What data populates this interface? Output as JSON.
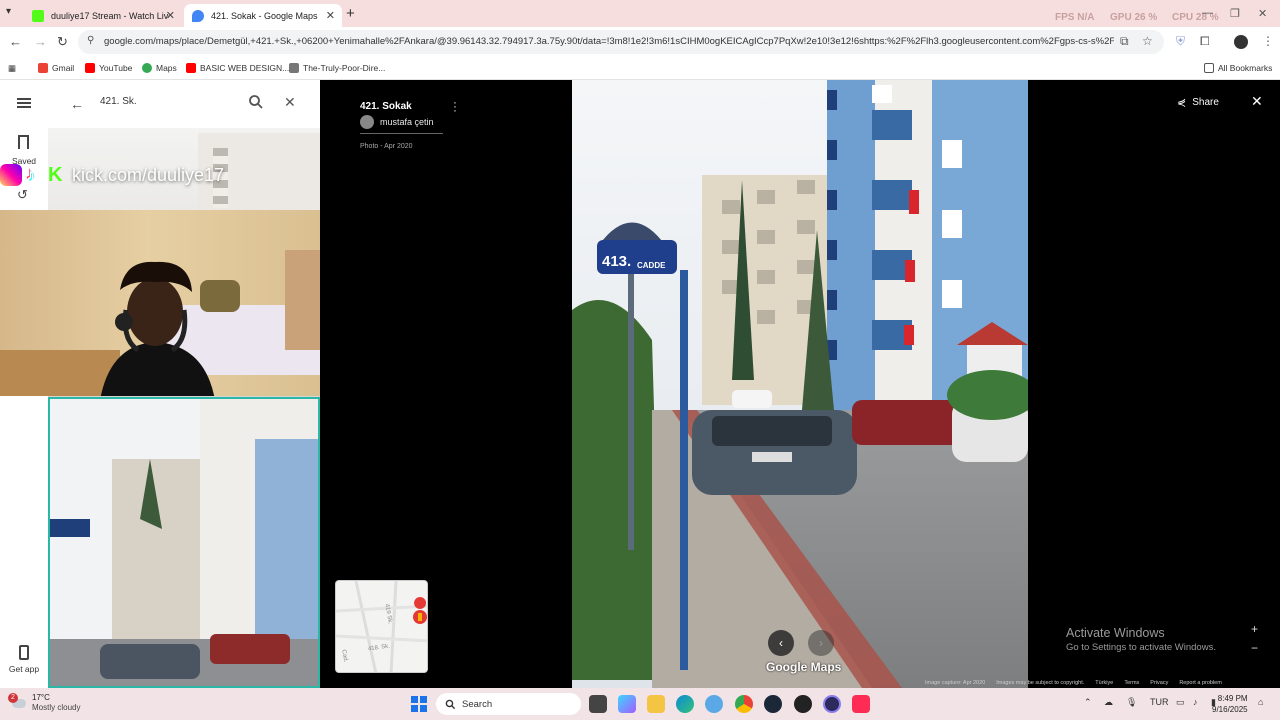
{
  "browser": {
    "tabs": [
      {
        "title": "duuliye17 Stream - Watch Live",
        "favicon_color": "#53fc18"
      },
      {
        "title": "421. Sokak - Google Maps",
        "favicon_color": "#4285f4"
      }
    ],
    "hud": {
      "fps": "FPS N/A",
      "gpu": "GPU 26 %",
      "cpu": "CPU 28 %"
    },
    "url": "google.com/maps/place/Demetgül,+421.+Sk.,+06200+Yenimahalle%2FAnkara/@39.96143.32.794917.3a.75y.90t/data=!3m8!1e2!3m6!1sCIHM0ogKEICAgICcp7PqXw!2e10!3e12!6shttps:%2F%2Flh3.googleusercontent.com%2Fgps-cs-s%2FAC9h4...",
    "bookmarks": [
      {
        "label": "Gmail",
        "color": "#ea4335"
      },
      {
        "label": "YouTube",
        "color": "#ff0000"
      },
      {
        "label": "Maps",
        "color": "#34a853"
      },
      {
        "label": "BASIC WEB DESIGN...",
        "color": "#ff0000"
      },
      {
        "label": "The-Truly-Poor-Dire...",
        "color": "#555555"
      }
    ],
    "all_bookmarks": "All Bookmarks"
  },
  "maps": {
    "rail": {
      "saved": "Saved",
      "get_app": "Get app"
    },
    "search": {
      "value": "421. Sk."
    },
    "viewer": {
      "title": "421. Sokak",
      "author": "mustafa çetin",
      "date": "Photo - Apr 2020",
      "share": "Share",
      "watermark": "Google Maps",
      "footer": [
        "Image capture: Apr 2020",
        "Images may be subject to copyright.",
        "Türkiye",
        "Terms",
        "Privacy",
        "Report a problem"
      ],
      "street_sign": {
        "number": "413.",
        "name": "CADDE"
      }
    },
    "minimap": {
      "streets": [
        "419 Sk.",
        "418. Sk.",
        "Cad."
      ]
    }
  },
  "stream": {
    "kick_url": "kick.com/duuliye17"
  },
  "windows": {
    "activate_title": "Activate Windows",
    "activate_sub": "Go to Settings to activate Windows."
  },
  "taskbar": {
    "weather": {
      "temp": "17°C",
      "condition": "Mostly cloudy",
      "badge": "2"
    },
    "search_placeholder": "Search",
    "language": "TUR",
    "time": "8:49 PM",
    "date": "9/16/2025"
  }
}
